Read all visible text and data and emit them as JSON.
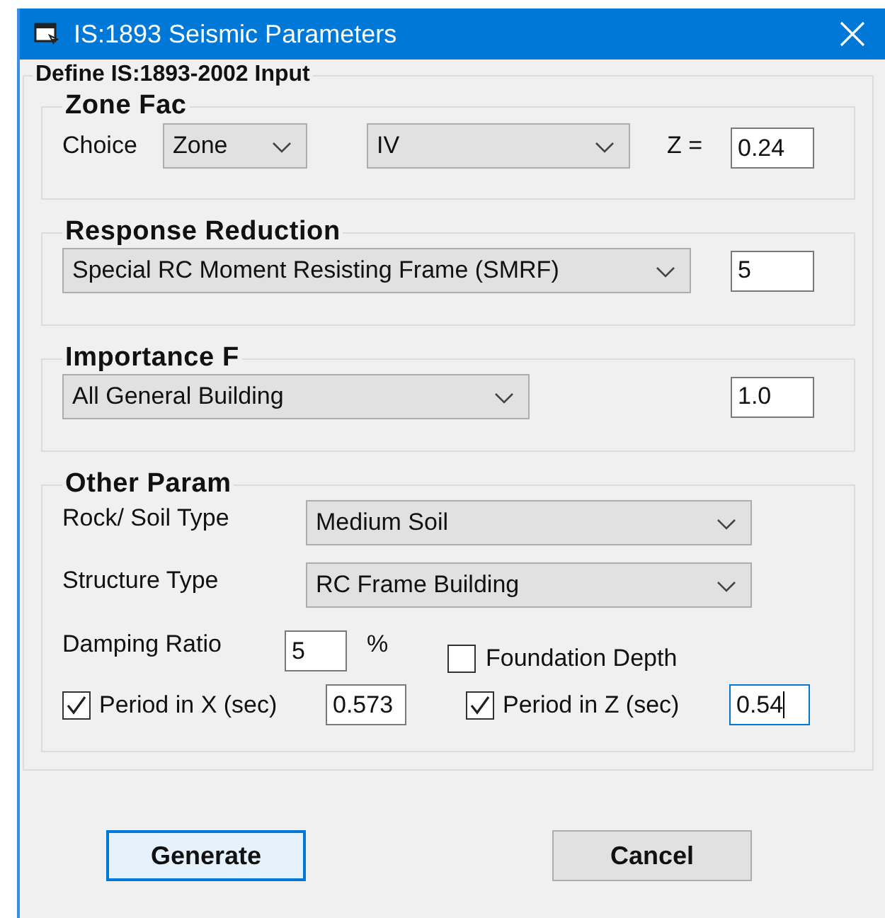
{
  "window": {
    "title": "IS:1893 Seismic Parameters"
  },
  "frame_title": "Define IS:1893-2002 Input",
  "zone_factor": {
    "title": "Zone Fac",
    "choice_label": "Choice",
    "choice": "Zone",
    "zone": "IV",
    "z_label": "Z =",
    "z_value": "0.24"
  },
  "response_reduction": {
    "title": "Response Reduction",
    "frame": "Special RC Moment Resisting Frame (SMRF)",
    "value": "5"
  },
  "importance": {
    "title": "Importance F",
    "building": "All General Building",
    "value": "1.0"
  },
  "other": {
    "title": "Other Param",
    "soil_label": "Rock/ Soil Type",
    "soil": "Medium Soil",
    "structure_label": "Structure Type",
    "structure": "RC Frame Building",
    "damping_label": "Damping Ratio",
    "damping": "5",
    "damping_unit": "%",
    "foundation": {
      "label": "Foundation Depth",
      "checked": false
    },
    "period_x": {
      "label": "Period in X (sec)",
      "checked": true,
      "value": "0.573",
      "focused": false
    },
    "period_z": {
      "label": "Period in Z (sec)",
      "checked": true,
      "value": "0.54",
      "focused": true
    }
  },
  "buttons": [
    {
      "label": "Generate",
      "default": true
    },
    {
      "label": "Cancel",
      "default": false
    }
  ]
}
